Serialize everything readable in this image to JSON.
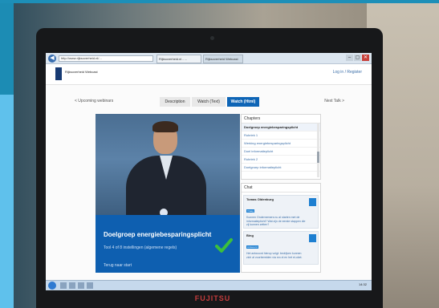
{
  "browser": {
    "url": "http://www.rijksoverheid.nl/...",
    "tabs": [
      "Rijksoverheid.nl - ...",
      "Rijksoverheid Webcast"
    ],
    "window_buttons": [
      "–",
      "▢",
      "✕"
    ]
  },
  "site": {
    "logo_text": "Rijksoverheid Webcast",
    "login": "Log in / Register"
  },
  "nav": {
    "back_label": "< Upcoming webinars",
    "tabs": [
      "Description",
      "Watch (Text)",
      "Watch (Html)"
    ],
    "next_label": "Next Talk >"
  },
  "video": {
    "title": "Doelgroep energiebesparingsplicht",
    "subtitle": "Tool 4 of 8 instellingen (algemene regels)",
    "link": "Terug naar start"
  },
  "chapters": {
    "heading": "Chapters",
    "items": [
      "Doelgroep energiebesparingsplicht",
      "Rubriek 1",
      "Werking energiebesparingsplicht",
      "Doel informatieplicht",
      "Rubriek 2",
      "Doelgroep informatieplicht"
    ]
  },
  "chat": {
    "heading": "Chat",
    "messages": [
      {
        "author": "Tomas Oldenburg",
        "tag": "Vraag",
        "text": "Kunnen Ondernemers nu al starten met de informatieplicht? Wat zijn de eerste stappen die zij kunnen zetten?"
      },
      {
        "author": "Bing",
        "tag": "Antwoord",
        "text": "Het antwoord hierop volgt: bedrijven kunnen zich al voorbereiden via rvo.nl en het eLoket."
      }
    ]
  },
  "taskbar": {
    "clock": "14:32"
  },
  "monitor": {
    "brand": "FUJITSU"
  },
  "colors": {
    "accent_blue": "#0e65b6",
    "caption_blue": "#0e5fb0",
    "check_green": "#3cbf3c",
    "frame": "#17181a"
  }
}
